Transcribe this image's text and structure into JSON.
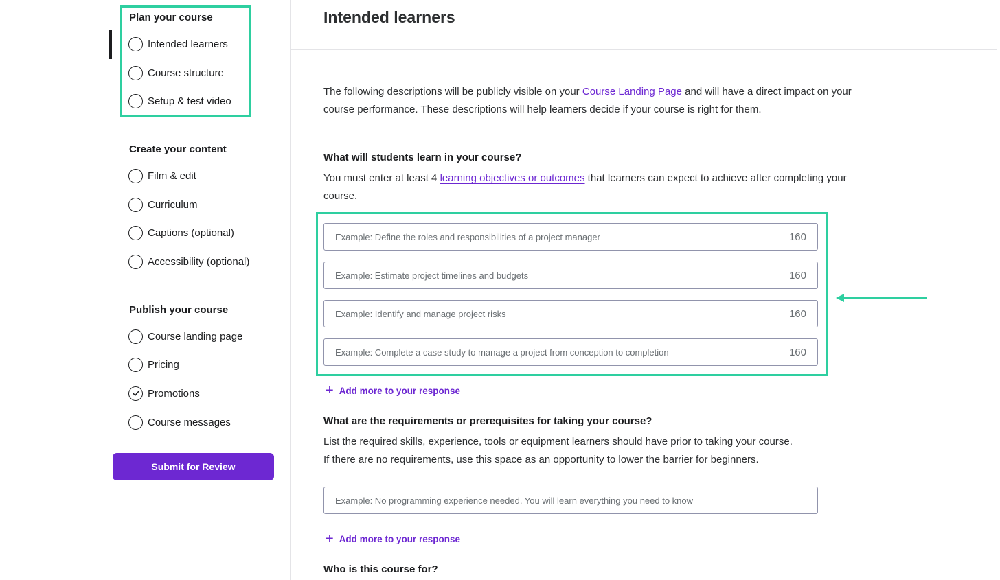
{
  "sidebar": {
    "sections": [
      {
        "title": "Plan your course",
        "items": [
          {
            "label": "Intended learners",
            "checked": false
          },
          {
            "label": "Course structure",
            "checked": false
          },
          {
            "label": "Setup & test video",
            "checked": false
          }
        ]
      },
      {
        "title": "Create your content",
        "items": [
          {
            "label": "Film & edit",
            "checked": false
          },
          {
            "label": "Curriculum",
            "checked": false
          },
          {
            "label": "Captions (optional)",
            "checked": false
          },
          {
            "label": "Accessibility (optional)",
            "checked": false
          }
        ]
      },
      {
        "title": "Publish your course",
        "items": [
          {
            "label": "Course landing page",
            "checked": false
          },
          {
            "label": "Pricing",
            "checked": false
          },
          {
            "label": "Promotions",
            "checked": true
          },
          {
            "label": "Course messages",
            "checked": false
          }
        ]
      }
    ],
    "submit_label": "Submit for Review"
  },
  "main": {
    "title": "Intended learners",
    "intro": {
      "before": "The following descriptions will be publicly visible on your ",
      "link": "Course Landing Page",
      "after": " and will have a direct impact on your course performance. These descriptions will help learners decide if your course is right for them."
    },
    "q1": {
      "title": "What will students learn in your course?",
      "desc_before": "You must enter at least 4 ",
      "desc_link": "learning objectives or outcomes",
      "desc_after": " that learners can expect to achieve after completing your course.",
      "fields": [
        {
          "placeholder": "Example: Define the roles and responsibilities of a project manager",
          "count": "160"
        },
        {
          "placeholder": "Example: Estimate project timelines and budgets",
          "count": "160"
        },
        {
          "placeholder": "Example: Identify and manage project risks",
          "count": "160"
        },
        {
          "placeholder": "Example: Complete a case study to manage a project from conception to completion",
          "count": "160"
        }
      ],
      "add_more": "Add more to your response"
    },
    "q2": {
      "title": "What are the requirements or prerequisites for taking your course?",
      "desc_line1": "List the required skills, experience, tools or equipment learners should have prior to taking your course.",
      "desc_line2": "If there are no requirements, use this space as an opportunity to lower the barrier for beginners.",
      "field_placeholder": "Example: No programming experience needed. You will learn everything you need to know",
      "add_more": "Add more to your response"
    },
    "q3": {
      "title": "Who is this course for?"
    }
  },
  "colors": {
    "accent": "#6d28d2",
    "highlight": "#2ecfa0",
    "text": "#1c1d1f"
  }
}
